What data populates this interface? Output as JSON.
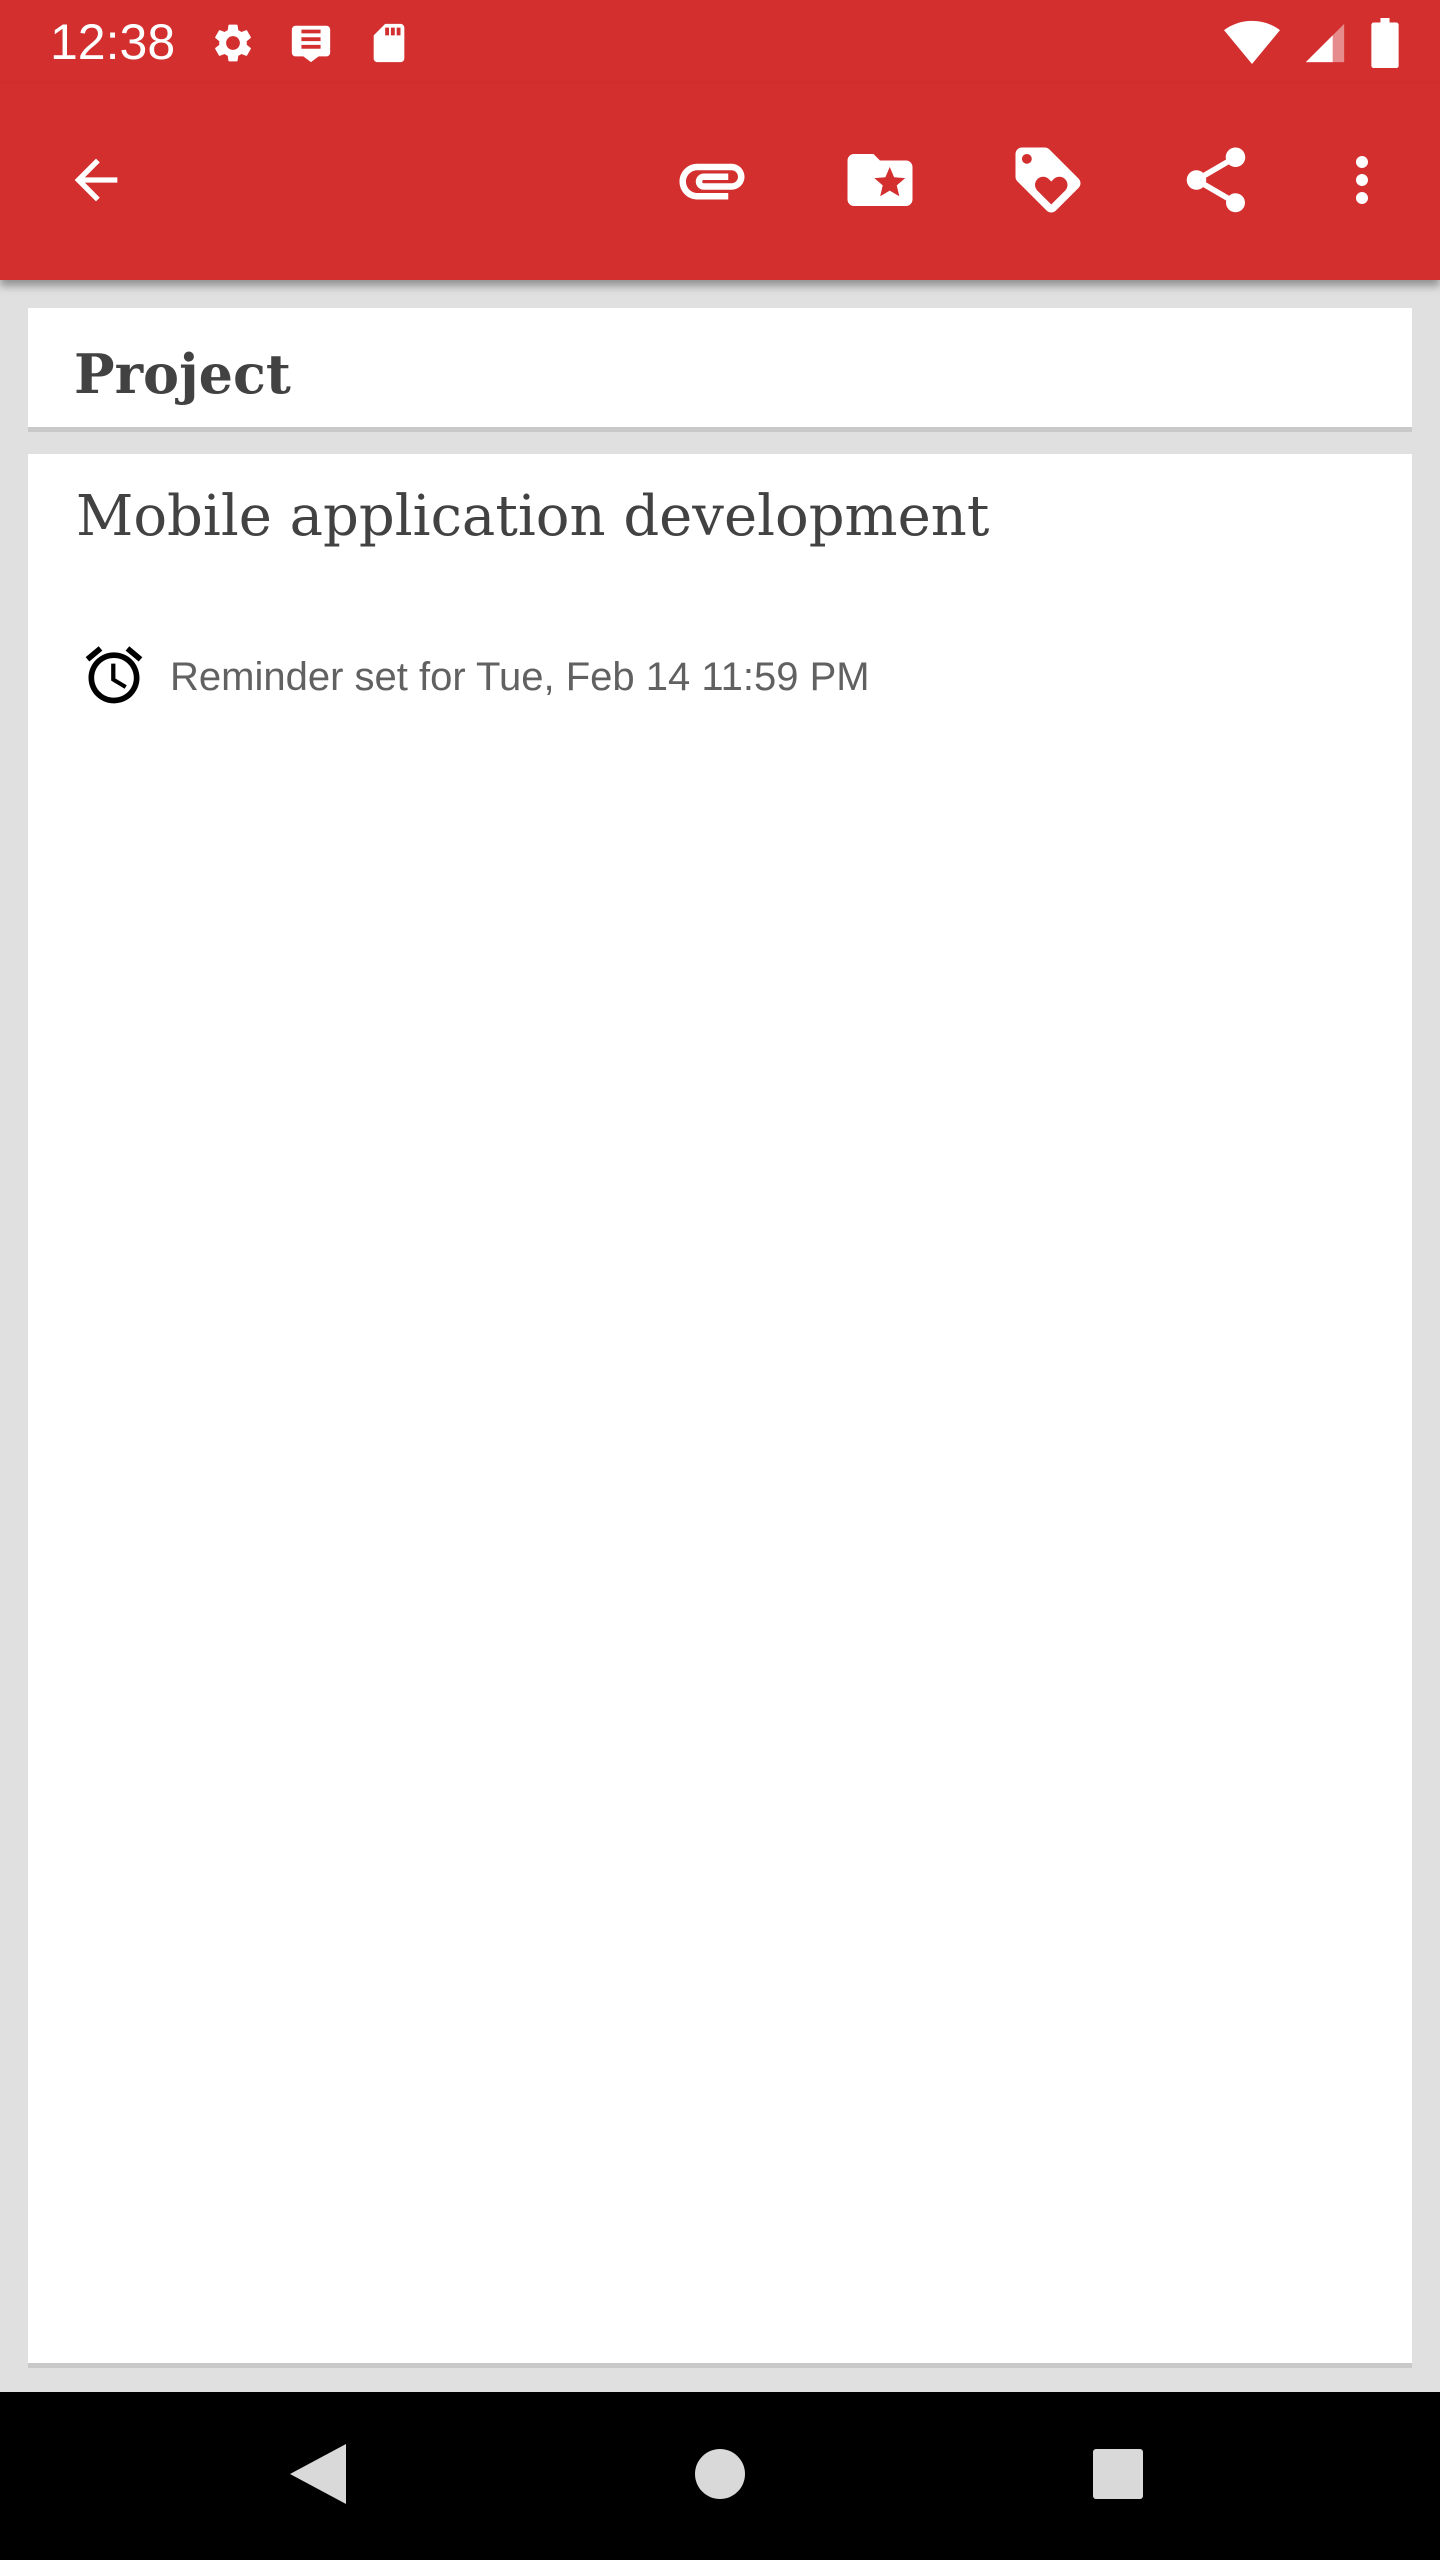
{
  "status_bar": {
    "time": "12:38",
    "left_icons": [
      "settings-icon",
      "notes-icon",
      "sd-card-icon"
    ],
    "right_icons": [
      "wifi-icon",
      "signal-icon",
      "battery-icon"
    ]
  },
  "toolbar": {
    "color": "#d32f2f",
    "buttons": [
      "back-arrow-icon",
      "attachment-icon",
      "category-folder-icon",
      "tag-icon",
      "share-icon",
      "more-vert-icon"
    ]
  },
  "category": {
    "label": "Project"
  },
  "note": {
    "title": "Mobile application development",
    "reminder": "Reminder set for Tue, Feb 14 11:59 PM"
  },
  "nav_bar": {
    "buttons": [
      "nav-back-icon",
      "nav-home-icon",
      "nav-recents-icon"
    ]
  }
}
